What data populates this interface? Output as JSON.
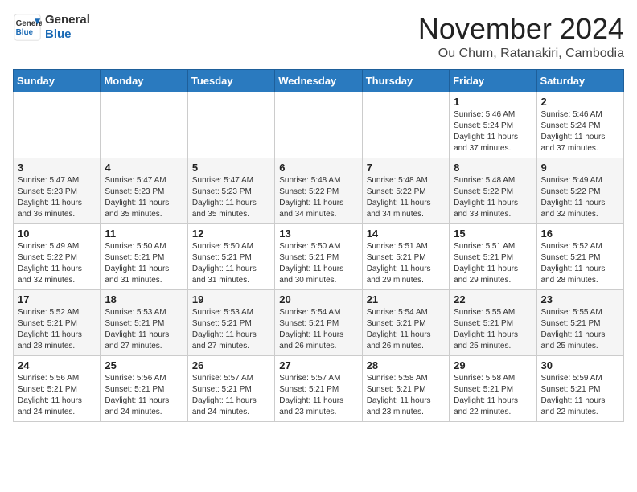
{
  "header": {
    "logo": {
      "general": "General",
      "blue": "Blue"
    },
    "title": "November 2024",
    "location": "Ou Chum, Ratanakiri, Cambodia"
  },
  "calendar": {
    "weekdays": [
      "Sunday",
      "Monday",
      "Tuesday",
      "Wednesday",
      "Thursday",
      "Friday",
      "Saturday"
    ],
    "weeks": [
      [
        {
          "day": "",
          "info": ""
        },
        {
          "day": "",
          "info": ""
        },
        {
          "day": "",
          "info": ""
        },
        {
          "day": "",
          "info": ""
        },
        {
          "day": "",
          "info": ""
        },
        {
          "day": "1",
          "info": "Sunrise: 5:46 AM\nSunset: 5:24 PM\nDaylight: 11 hours\nand 37 minutes."
        },
        {
          "day": "2",
          "info": "Sunrise: 5:46 AM\nSunset: 5:24 PM\nDaylight: 11 hours\nand 37 minutes."
        }
      ],
      [
        {
          "day": "3",
          "info": "Sunrise: 5:47 AM\nSunset: 5:23 PM\nDaylight: 11 hours\nand 36 minutes."
        },
        {
          "day": "4",
          "info": "Sunrise: 5:47 AM\nSunset: 5:23 PM\nDaylight: 11 hours\nand 35 minutes."
        },
        {
          "day": "5",
          "info": "Sunrise: 5:47 AM\nSunset: 5:23 PM\nDaylight: 11 hours\nand 35 minutes."
        },
        {
          "day": "6",
          "info": "Sunrise: 5:48 AM\nSunset: 5:22 PM\nDaylight: 11 hours\nand 34 minutes."
        },
        {
          "day": "7",
          "info": "Sunrise: 5:48 AM\nSunset: 5:22 PM\nDaylight: 11 hours\nand 34 minutes."
        },
        {
          "day": "8",
          "info": "Sunrise: 5:48 AM\nSunset: 5:22 PM\nDaylight: 11 hours\nand 33 minutes."
        },
        {
          "day": "9",
          "info": "Sunrise: 5:49 AM\nSunset: 5:22 PM\nDaylight: 11 hours\nand 32 minutes."
        }
      ],
      [
        {
          "day": "10",
          "info": "Sunrise: 5:49 AM\nSunset: 5:22 PM\nDaylight: 11 hours\nand 32 minutes."
        },
        {
          "day": "11",
          "info": "Sunrise: 5:50 AM\nSunset: 5:21 PM\nDaylight: 11 hours\nand 31 minutes."
        },
        {
          "day": "12",
          "info": "Sunrise: 5:50 AM\nSunset: 5:21 PM\nDaylight: 11 hours\nand 31 minutes."
        },
        {
          "day": "13",
          "info": "Sunrise: 5:50 AM\nSunset: 5:21 PM\nDaylight: 11 hours\nand 30 minutes."
        },
        {
          "day": "14",
          "info": "Sunrise: 5:51 AM\nSunset: 5:21 PM\nDaylight: 11 hours\nand 29 minutes."
        },
        {
          "day": "15",
          "info": "Sunrise: 5:51 AM\nSunset: 5:21 PM\nDaylight: 11 hours\nand 29 minutes."
        },
        {
          "day": "16",
          "info": "Sunrise: 5:52 AM\nSunset: 5:21 PM\nDaylight: 11 hours\nand 28 minutes."
        }
      ],
      [
        {
          "day": "17",
          "info": "Sunrise: 5:52 AM\nSunset: 5:21 PM\nDaylight: 11 hours\nand 28 minutes."
        },
        {
          "day": "18",
          "info": "Sunrise: 5:53 AM\nSunset: 5:21 PM\nDaylight: 11 hours\nand 27 minutes."
        },
        {
          "day": "19",
          "info": "Sunrise: 5:53 AM\nSunset: 5:21 PM\nDaylight: 11 hours\nand 27 minutes."
        },
        {
          "day": "20",
          "info": "Sunrise: 5:54 AM\nSunset: 5:21 PM\nDaylight: 11 hours\nand 26 minutes."
        },
        {
          "day": "21",
          "info": "Sunrise: 5:54 AM\nSunset: 5:21 PM\nDaylight: 11 hours\nand 26 minutes."
        },
        {
          "day": "22",
          "info": "Sunrise: 5:55 AM\nSunset: 5:21 PM\nDaylight: 11 hours\nand 25 minutes."
        },
        {
          "day": "23",
          "info": "Sunrise: 5:55 AM\nSunset: 5:21 PM\nDaylight: 11 hours\nand 25 minutes."
        }
      ],
      [
        {
          "day": "24",
          "info": "Sunrise: 5:56 AM\nSunset: 5:21 PM\nDaylight: 11 hours\nand 24 minutes."
        },
        {
          "day": "25",
          "info": "Sunrise: 5:56 AM\nSunset: 5:21 PM\nDaylight: 11 hours\nand 24 minutes."
        },
        {
          "day": "26",
          "info": "Sunrise: 5:57 AM\nSunset: 5:21 PM\nDaylight: 11 hours\nand 24 minutes."
        },
        {
          "day": "27",
          "info": "Sunrise: 5:57 AM\nSunset: 5:21 PM\nDaylight: 11 hours\nand 23 minutes."
        },
        {
          "day": "28",
          "info": "Sunrise: 5:58 AM\nSunset: 5:21 PM\nDaylight: 11 hours\nand 23 minutes."
        },
        {
          "day": "29",
          "info": "Sunrise: 5:58 AM\nSunset: 5:21 PM\nDaylight: 11 hours\nand 22 minutes."
        },
        {
          "day": "30",
          "info": "Sunrise: 5:59 AM\nSunset: 5:21 PM\nDaylight: 11 hours\nand 22 minutes."
        }
      ]
    ]
  }
}
